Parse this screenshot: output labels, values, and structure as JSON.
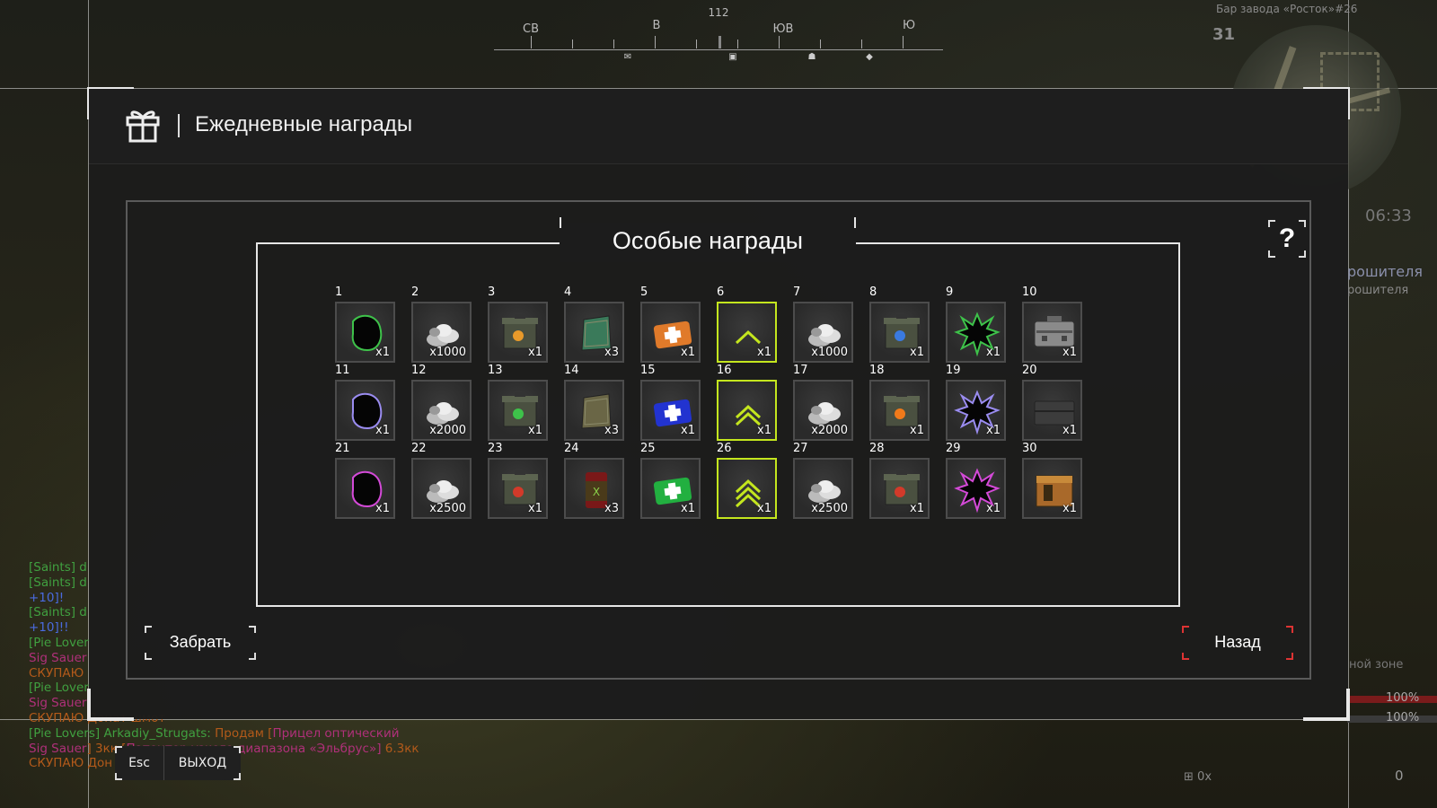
{
  "hud": {
    "compass": {
      "heading": "112",
      "labels": [
        "СВ",
        "В",
        "ЮВ",
        "Ю"
      ]
    },
    "zone_name": "Бар завода «Росток»#26",
    "level": "31",
    "clock": "06:33",
    "right_text_1": "рошителя",
    "right_text_2": "рошителя",
    "right_text_3": "ной зоне",
    "pct_1": "100%",
    "pct_2": "100%",
    "small_counter": "0х",
    "bottom_counter": "0"
  },
  "chat": {
    "lines": [
      {
        "a": "[Saints] d",
        "b": ""
      },
      {
        "a": "[Saints] d",
        "b": ""
      },
      {
        "a": "+10",
        "b": "]!"
      },
      {
        "a": "[Saints] d",
        "b": ""
      },
      {
        "a": "+10",
        "b": "]!!"
      },
      {
        "a": "[Pie Lover",
        "b": ""
      },
      {
        "a": "Sig Sauer",
        "b": ""
      },
      {
        "a": "СКУПАЮ",
        "b": ""
      },
      {
        "a": "[Pie Lover",
        "b": ""
      },
      {
        "a": "Sig Sauer",
        "b": ""
      },
      {
        "a": "СКУПАЮ Донат шмот",
        "b": ""
      },
      {
        "a": "[Pie Lovers] Arkadiy_Strugats:",
        "b": " Продам [",
        "c": "Прицел оптический"
      },
      {
        "a": "Sig Sauer",
        "b": "] 3кк [",
        "c": "Патентор узкого диапазона «Эльбрус»] ",
        "d": "6.3кк"
      },
      {
        "a": "СКУПАЮ Дон",
        "b": ""
      }
    ]
  },
  "window": {
    "title": "Ежедневные награды",
    "section_title": "Особые награды",
    "help_label": "?",
    "claim_label": "Забрать",
    "back_label": "Назад"
  },
  "footer": {
    "esc_label": "Esc",
    "exit_label": "ВЫХОД"
  },
  "rewards": [
    {
      "day": "1",
      "qty": "x1",
      "icon": "green-hood-icon"
    },
    {
      "day": "2",
      "qty": "x1000",
      "icon": "silver-pile-icon"
    },
    {
      "day": "3",
      "qty": "x1",
      "icon": "ammo-box-orange-icon"
    },
    {
      "day": "4",
      "qty": "x3",
      "icon": "green-blanket-icon"
    },
    {
      "day": "5",
      "qty": "x1",
      "icon": "orange-medkit-icon"
    },
    {
      "day": "6",
      "qty": "x1",
      "icon": "rank-chevron-1-icon",
      "active": true
    },
    {
      "day": "7",
      "qty": "x1000",
      "icon": "silver-pile-icon"
    },
    {
      "day": "8",
      "qty": "x1",
      "icon": "ammo-box-blue-icon"
    },
    {
      "day": "9",
      "qty": "x1",
      "icon": "green-splat-icon"
    },
    {
      "day": "10",
      "qty": "x1",
      "icon": "metal-case-icon"
    },
    {
      "day": "11",
      "qty": "x1",
      "icon": "purple-hood-icon"
    },
    {
      "day": "12",
      "qty": "x2000",
      "icon": "silver-pile-icon"
    },
    {
      "day": "13",
      "qty": "x1",
      "icon": "ammo-box-green-icon"
    },
    {
      "day": "14",
      "qty": "x3",
      "icon": "khaki-blanket-icon"
    },
    {
      "day": "15",
      "qty": "x1",
      "icon": "blue-medkit-icon"
    },
    {
      "day": "16",
      "qty": "x1",
      "icon": "rank-chevron-2-icon",
      "active": true
    },
    {
      "day": "17",
      "qty": "x2000",
      "icon": "silver-pile-icon"
    },
    {
      "day": "18",
      "qty": "x1",
      "icon": "ammo-box-fire-icon"
    },
    {
      "day": "19",
      "qty": "x1",
      "icon": "purple-splat-icon"
    },
    {
      "day": "20",
      "qty": "x1",
      "icon": "dark-case-icon"
    },
    {
      "day": "21",
      "qty": "x1",
      "icon": "pink-hood-icon"
    },
    {
      "day": "22",
      "qty": "x2500",
      "icon": "silver-pile-icon"
    },
    {
      "day": "23",
      "qty": "x1",
      "icon": "ammo-box-red-icon"
    },
    {
      "day": "24",
      "qty": "x3",
      "icon": "red-can-icon"
    },
    {
      "day": "25",
      "qty": "x1",
      "icon": "green-medkit-icon"
    },
    {
      "day": "26",
      "qty": "x1",
      "icon": "rank-chevron-3-icon",
      "active": true
    },
    {
      "day": "27",
      "qty": "x2500",
      "icon": "silver-pile-icon"
    },
    {
      "day": "28",
      "qty": "x1",
      "icon": "ammo-box-red-chevron-icon"
    },
    {
      "day": "29",
      "qty": "x1",
      "icon": "pink-splat-icon"
    },
    {
      "day": "30",
      "qty": "x1",
      "icon": "wooden-crate-icon"
    }
  ]
}
